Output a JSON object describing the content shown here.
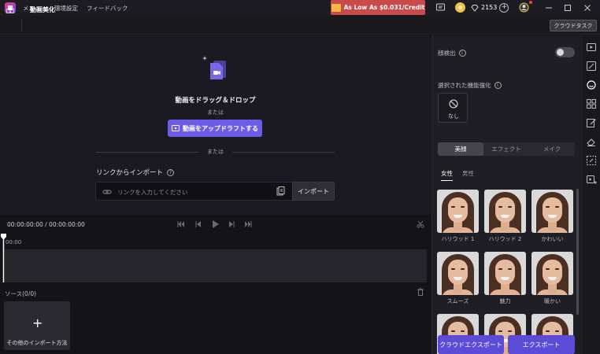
{
  "menubar": {
    "items": [
      "メニュー",
      "環境設定",
      "フィードバック"
    ],
    "promo": "As Low As $0.031/Credit",
    "credits": "2153"
  },
  "tabbar": {
    "title": "動画美化",
    "cloud_task": "クラウドタスク"
  },
  "upload": {
    "title": "動画をドラッグ＆ドロップ",
    "or_text": "または",
    "upload_button": "動画をアップドラフトする",
    "or_divider": "または",
    "link_label": "リンクからインポート",
    "link_placeholder": "リンクを入力してください",
    "import_button": "インポート"
  },
  "player": {
    "time": "00:00:00:00 / 00:00:00:00",
    "ruler_start": "00:00"
  },
  "source": {
    "label": "ソース(0/0)",
    "more_import": "その他のインポート方法"
  },
  "panel": {
    "face_detect": "顔検出",
    "face_detect_on": false,
    "selected_label": "選択された機能強化",
    "none_label": "なし",
    "segments": [
      "美顔",
      "エフェクト",
      "メイク"
    ],
    "active_segment": 0,
    "gender_tabs": [
      "女性",
      "男性"
    ],
    "presets": [
      "ハリウッド 1",
      "ハリウッド 2",
      "かわいい",
      "スムーズ",
      "魅力",
      "暖かい",
      "",
      "",
      ""
    ],
    "cloud_export": "クラウドエクスポート",
    "export": "エクスポート"
  },
  "colors": {
    "accent": "#6c5ce7",
    "export": "#5b4bd6",
    "promo": "#c94a4a"
  }
}
